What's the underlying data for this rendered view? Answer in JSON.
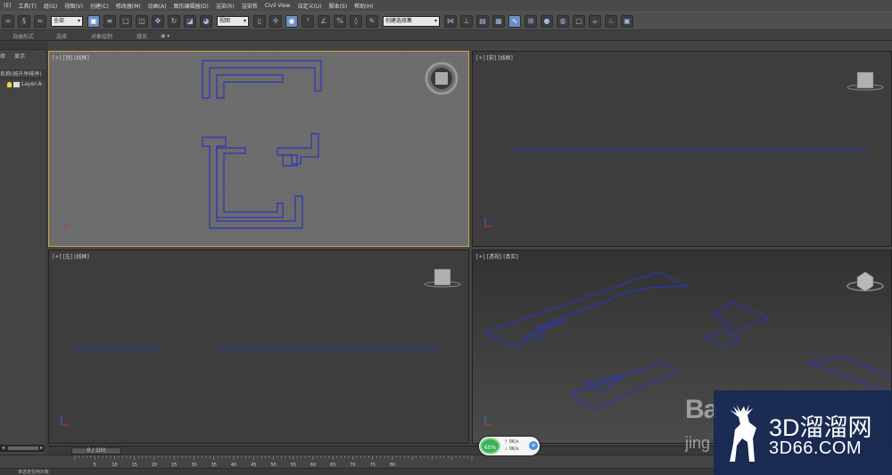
{
  "menu": [
    "(E)",
    "工具(T)",
    "组(G)",
    "视图(V)",
    "创建(C)",
    "修改器(M)",
    "动画(A)",
    "图形编辑器(D)",
    "渲染(R)",
    "渲染铁",
    "Civil View",
    "自定义(U)",
    "脚本(S)",
    "帮助(H)"
  ],
  "toolbar": {
    "selection_filter": "全部",
    "ref_coord": "视图",
    "named_selection": "创建选择集"
  },
  "ribbon_tabs": [
    "自由形式",
    "选择",
    "对象绘制",
    "填充"
  ],
  "ribbon_extra": "◉ ▾",
  "scene_explorer": {
    "tab_select": "择",
    "tab_display": "显示",
    "column_header": "名称(按升序排序)",
    "rows": [
      "Layer:A"
    ]
  },
  "viewports": {
    "top": "[+] [顶] [线框]",
    "front": "[+] [前] [线框]",
    "left": "[+] [左] [线框]",
    "persp": "[+] [透视] [真实]"
  },
  "time_slider": {
    "label": "0 / 100"
  },
  "timeline_ticks": [
    "5",
    "10",
    "15",
    "20",
    "25",
    "30",
    "35",
    "40",
    "45",
    "50",
    "55",
    "60",
    "65",
    "70",
    "75",
    "80"
  ],
  "status": {
    "prompt": "未选定任何对象"
  },
  "net_widget": {
    "percent": "65%",
    "up": "0K/s",
    "down": "0K/s",
    "plus": "+"
  },
  "watermark": {
    "baidu": "Ba",
    "jing": "jing",
    "brand_title": "3D溜溜网",
    "brand_url": "3D66.COM"
  },
  "colors": {
    "wire": "#2a37b8",
    "active_border": "#c9a640",
    "panel": "#444444",
    "brand_bg": "#182a54"
  }
}
